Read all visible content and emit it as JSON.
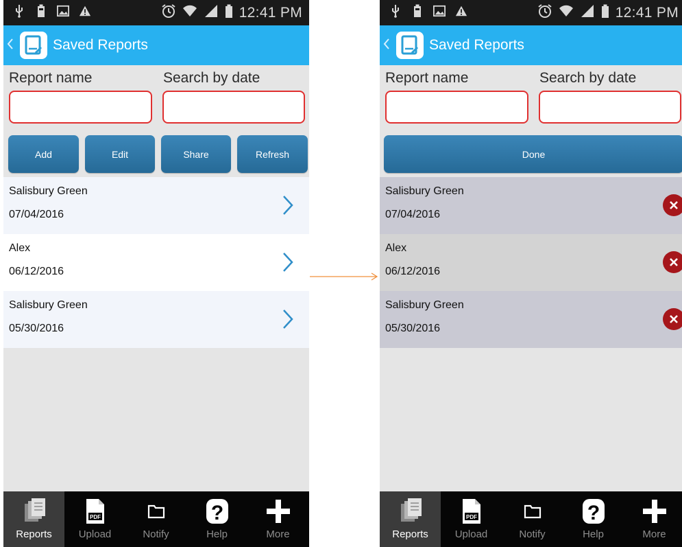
{
  "screens": [
    {
      "status": {
        "time": "12:41 PM"
      },
      "header": {
        "title": "Saved Reports"
      },
      "search": {
        "report_name_label": "Report name",
        "date_label": "Search by date",
        "report_name_value": "",
        "date_value": ""
      },
      "buttons": {
        "add": "Add",
        "edit": "Edit",
        "share": "Share",
        "refresh": "Refresh"
      },
      "reports": [
        {
          "name": "Salisbury Green",
          "date": "07/04/2016"
        },
        {
          "name": "Alex",
          "date": "06/12/2016"
        },
        {
          "name": "Salisbury Green",
          "date": "05/30/2016"
        }
      ],
      "tabs": [
        {
          "label": "Reports",
          "icon": "reports-icon"
        },
        {
          "label": "Upload",
          "icon": "pdf-upload-icon"
        },
        {
          "label": "Notify",
          "icon": "folder-icon"
        },
        {
          "label": "Help",
          "icon": "help-icon"
        },
        {
          "label": "More",
          "icon": "plus-icon"
        }
      ]
    },
    {
      "status": {
        "time": "12:41 PM"
      },
      "header": {
        "title": "Saved Reports"
      },
      "search": {
        "report_name_label": "Report name",
        "date_label": "Search by date",
        "report_name_value": "",
        "date_value": ""
      },
      "buttons": {
        "done": "Done"
      },
      "reports": [
        {
          "name": "Salisbury Green",
          "date": "07/04/2016"
        },
        {
          "name": "Alex",
          "date": "06/12/2016"
        },
        {
          "name": "Salisbury Green",
          "date": "05/30/2016"
        }
      ],
      "tabs": [
        {
          "label": "Reports",
          "icon": "reports-icon"
        },
        {
          "label": "Upload",
          "icon": "pdf-upload-icon"
        },
        {
          "label": "Notify",
          "icon": "folder-icon"
        },
        {
          "label": "Help",
          "icon": "help-icon"
        },
        {
          "label": "More",
          "icon": "plus-icon"
        }
      ]
    }
  ],
  "colors": {
    "appbar": "#28b1f0",
    "statusbar": "#1a1a1a",
    "input_border": "#e03030",
    "button": "#2f79aa",
    "delete": "#a6161b",
    "chevron": "#2f8ec9",
    "row_light": "#f2f5fb",
    "row_white": "#ffffff",
    "row_edit_alt": "#c9c9d3",
    "row_edit": "#d3d3d3",
    "tabbar": "#060606",
    "tab_active": "#3b3b3b",
    "arrow": "#f0903c"
  }
}
